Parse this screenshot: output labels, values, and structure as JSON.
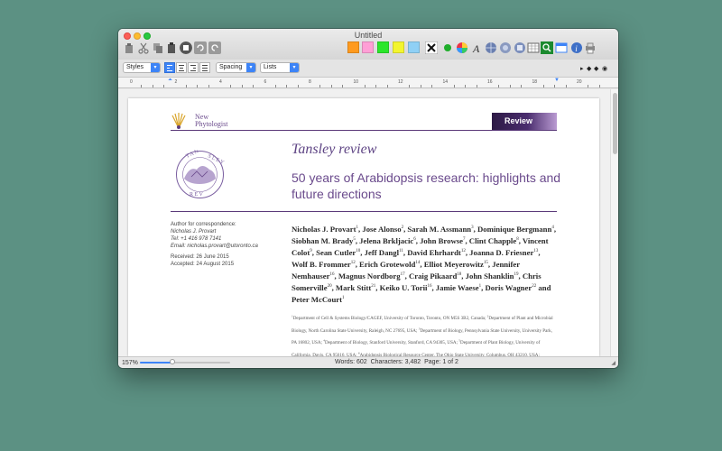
{
  "window": {
    "title": "Untitled"
  },
  "toolbar": {
    "tools": [
      "paste-icon",
      "cut-icon",
      "copy-icon",
      "clipboard-icon",
      "print-preview-icon",
      "undo-icon",
      "redo-icon"
    ],
    "colors": {
      "orange": "#ff9a1f",
      "pink": "#ff9fd6",
      "green": "#2be62b",
      "yellow": "#f3f52f",
      "light_blue": "#8fd0f5"
    },
    "right_tools": [
      "clear-format-icon",
      "green-dot-icon",
      "color-wheel-icon",
      "font-icon",
      "globe-icon",
      "network-icon",
      "insert-icon",
      "table-icon",
      "find-icon",
      "window-icon",
      "info-icon",
      "print-icon"
    ]
  },
  "formatbar": {
    "styles": "Styles",
    "spacing": "Spacing",
    "lists": "Lists"
  },
  "ruler": {
    "numbers": [
      "0",
      "2",
      "4",
      "6",
      "8",
      "10",
      "12",
      "14",
      "16",
      "18",
      "20"
    ]
  },
  "document": {
    "journal": "New Phytologist",
    "journal_line1": "New",
    "journal_line2": "Phytologist",
    "badge": "Review",
    "series": "Tansley review",
    "title": "50 years of Arabidopsis research: highlights and future directions",
    "author_correspondence_label": "Author for correspondence:",
    "correspondent": "Nicholas J. Provart",
    "tel": "Tel: +1 416 978 7141",
    "email": "Email: nicholas.provart@utoronto.ca",
    "received": "Received: 26 June 2015",
    "accepted": "Accepted: 24 August 2015",
    "authors": [
      {
        "name": "Nicholas J. Provart",
        "sup": "1",
        "sep": ", "
      },
      {
        "name": "Jose Alonso",
        "sup": "2",
        "sep": ", "
      },
      {
        "name": "Sarah M. Assmann",
        "sup": "3",
        "sep": ", "
      },
      {
        "name": "Dominique Bergmann",
        "sup": "4",
        "sep": ", "
      },
      {
        "name": "Siobhan M. Brady",
        "sup": "5",
        "sep": ", "
      },
      {
        "name": "Jelena Brkljacic",
        "sup": "6",
        "sep": ", "
      },
      {
        "name": "John Browse",
        "sup": "7",
        "sep": ", "
      },
      {
        "name": "Clint Chapple",
        "sup": "8",
        "sep": ", "
      },
      {
        "name": "Vincent Colot",
        "sup": "9",
        "sep": ", "
      },
      {
        "name": "Sean Cutler",
        "sup": "10",
        "sep": ", "
      },
      {
        "name": "Jeff Dangl",
        "sup": "11",
        "sep": ", "
      },
      {
        "name": "David Ehrhardt",
        "sup": "12",
        "sep": ", "
      },
      {
        "name": "Joanna D. Friesner",
        "sup": "13",
        "sep": ", "
      },
      {
        "name": "Wolf B. Frommer",
        "sup": "12",
        "sep": ", "
      },
      {
        "name": "Erich Grotewold",
        "sup": "14",
        "sep": ", "
      },
      {
        "name": "Elliot Meyerowitz",
        "sup": "15",
        "sep": ", "
      },
      {
        "name": "Jennifer Nemhauser",
        "sup": "16",
        "sep": ", "
      },
      {
        "name": "Magnus Nordborg",
        "sup": "17",
        "sep": ", "
      },
      {
        "name": "Craig Pikaard",
        "sup": "18",
        "sep": ", "
      },
      {
        "name": "John Shanklin",
        "sup": "19",
        "sep": ", "
      },
      {
        "name": "Chris Somerville",
        "sup": "20",
        "sep": ", "
      },
      {
        "name": "Mark Stitt",
        "sup": "21",
        "sep": ", "
      },
      {
        "name": "Keiko U. Torii",
        "sup": "16",
        "sep": ", "
      },
      {
        "name": "Jamie Waese",
        "sup": "1",
        "sep": ", "
      },
      {
        "name": "Doris Wagner",
        "sup": "22",
        "sep": " and "
      },
      {
        "name": "Peter McCourt",
        "sup": "1",
        "sep": ""
      }
    ],
    "affiliations": [
      {
        "sup": "1",
        "text": "Department of Cell & Systems Biology/CAGEF, University of Toronto, Toronto, ON M5S 3B2, Canada; "
      },
      {
        "sup": "2",
        "text": "Department of Plant and Microbial Biology, North Carolina State University, Raleigh, NC 27695, USA; "
      },
      {
        "sup": "3",
        "text": "Department of Biology, Pennsylvania State University, University Park, PA 16802, USA; "
      },
      {
        "sup": "4",
        "text": "Department of Biology, Stanford University, Stanford, CA 94305, USA; "
      },
      {
        "sup": "5",
        "text": "Department of Plant Biology, University of California, Davis, CA 95616, USA; "
      },
      {
        "sup": "6",
        "text": "Arabidopsis Biological Resource Center, The Ohio State University, Columbus, OH 43210, USA; "
      },
      {
        "sup": "7",
        "text": "Institute of Biological Chemistry, Washington State University, Pullman, WA 99164, USA;"
      }
    ]
  },
  "statusbar": {
    "zoom": "157%",
    "zoom_fraction": 0.6,
    "words": "Words: 602",
    "characters": "Characters: 3,482",
    "page": "Page: 1 of 2"
  }
}
